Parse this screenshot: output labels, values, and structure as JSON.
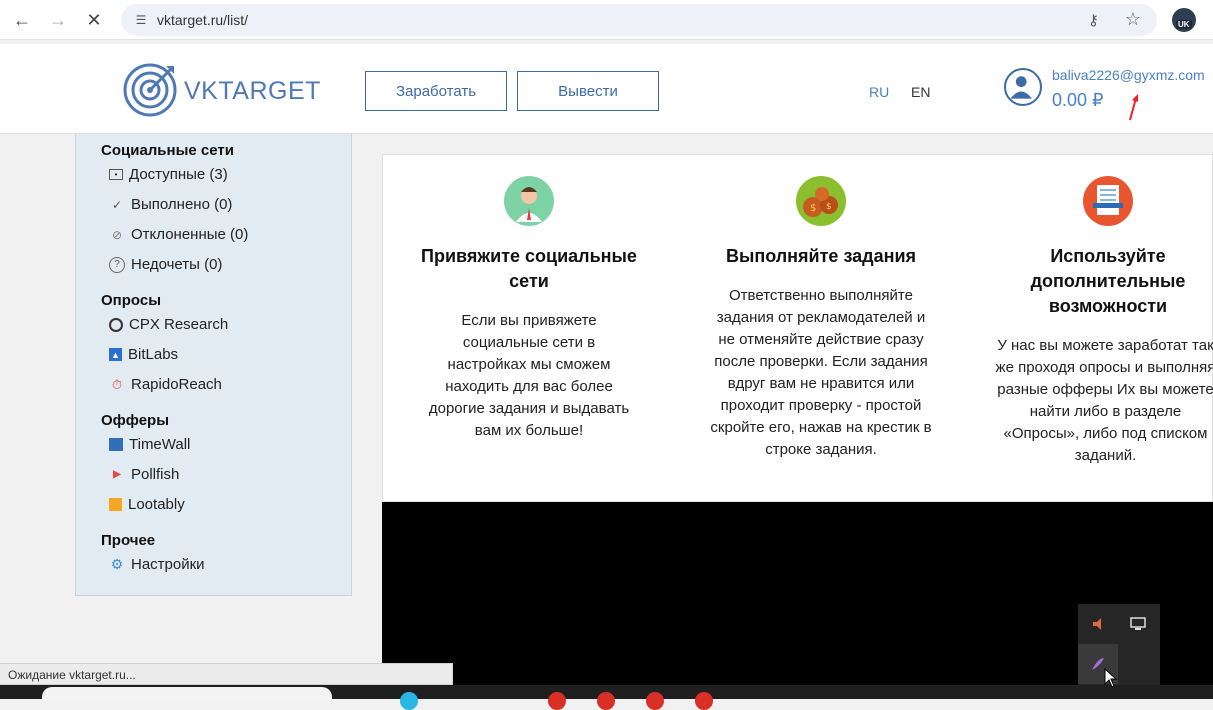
{
  "browser": {
    "url": "vktarget.ru/list/",
    "back_icon": "arrow-left-icon",
    "forward_icon": "arrow-right-icon",
    "stop_icon": "close-icon",
    "extension_badge": "UK"
  },
  "header": {
    "logo_text": "VKTARGET",
    "earn_button": "Заработать",
    "withdraw_button": "Вывести",
    "lang_ru": "RU",
    "lang_en": "EN",
    "email": "baliva2226@gyxmz.com",
    "balance": "0.00 ₽"
  },
  "sidebar": {
    "social_title": "Социальные сети",
    "social_items": [
      {
        "label": "Доступные (3)",
        "icon": "monitor-icon"
      },
      {
        "label": "Выполнено (0)",
        "icon": "check-icon"
      },
      {
        "label": "Отклоненные (0)",
        "icon": "ban-icon"
      },
      {
        "label": "Недочеты (0)",
        "icon": "question-icon"
      }
    ],
    "surveys_title": "Опросы",
    "survey_items": [
      {
        "label": "CPX Research",
        "icon": "cpx-icon"
      },
      {
        "label": "BitLabs",
        "icon": "flask-icon"
      },
      {
        "label": "RapidoReach",
        "icon": "rapidoreach-icon"
      }
    ],
    "offers_title": "Офферы",
    "offer_items": [
      {
        "label": "TimeWall",
        "icon": "timewall-icon"
      },
      {
        "label": "Pollfish",
        "icon": "pollfish-icon"
      },
      {
        "label": "Lootably",
        "icon": "lootably-icon"
      }
    ],
    "other_title": "Прочее",
    "other_items": [
      {
        "label": "Настройки",
        "icon": "gear-icon"
      }
    ]
  },
  "features": [
    {
      "title": "Привяжите социальные сети",
      "text": "Если вы привяжете социальные сети в настройках мы сможем находить для вас более дорогие задания и выдавать вам их больше!",
      "icon": "user-icon"
    },
    {
      "title": "Выполняйте задания",
      "text": "Ответственно выполняйте задания от рекламодателей и не отменяйте действие сразу после проверки. Если задания вдруг вам не нравится или проходит проверку - простой скройте его, нажав на крестик в строке задания.",
      "icon": "money-bags-icon"
    },
    {
      "title": "Используйте дополнительные возможности",
      "text": "У нас вы можете заработат так же проходя опросы и выполняя разные офферы Их вы можете найти либо в разделе «Опросы», либо под списком заданий.",
      "icon": "document-icon"
    }
  ],
  "status_bar": "Ожидание vktarget.ru...",
  "colors": {
    "brand": "#3d6aa8",
    "sidebar_bg": "#e3ebf2",
    "link": "#4a80c8"
  }
}
